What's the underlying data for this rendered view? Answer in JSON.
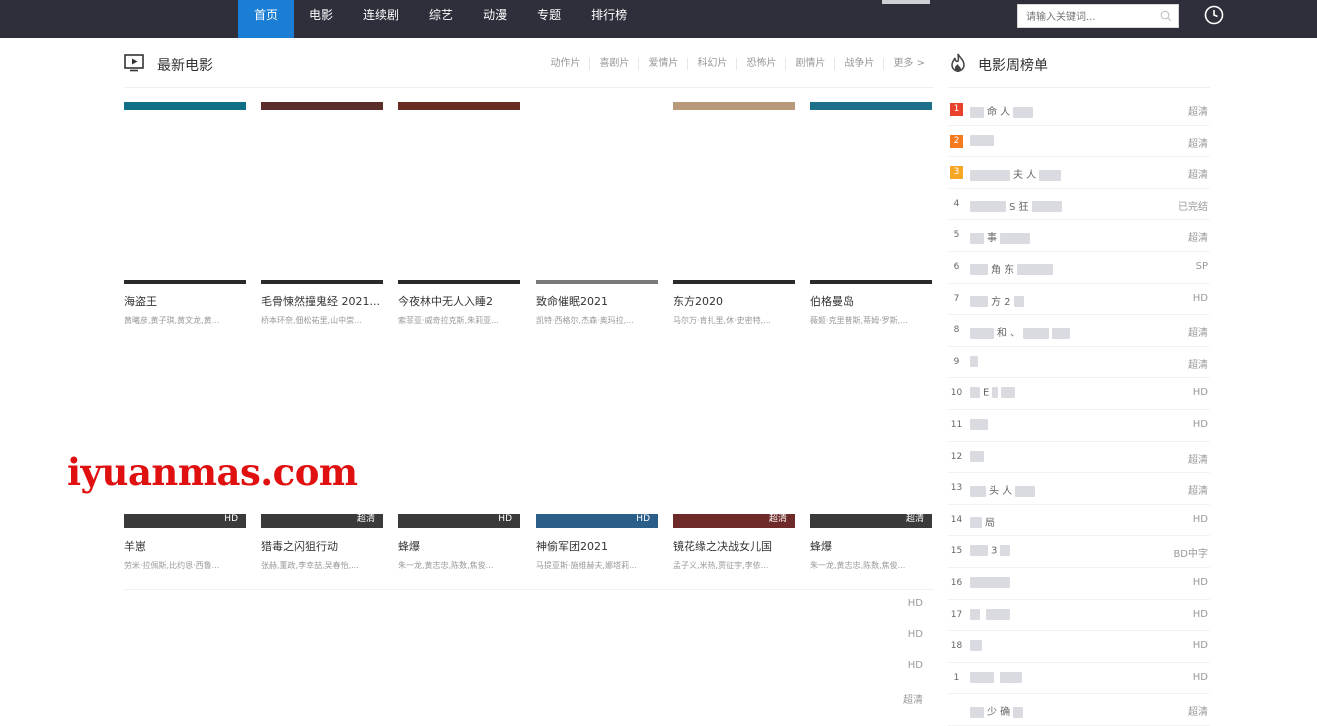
{
  "nav": {
    "items": [
      "首页",
      "电影",
      "连续剧",
      "综艺",
      "动漫",
      "专题",
      "排行榜"
    ],
    "active": "首页"
  },
  "search": {
    "placeholder": "请输入关键词..."
  },
  "section": {
    "title": "最新电影",
    "categories": [
      "动作片",
      "喜剧片",
      "爱情片",
      "科幻片",
      "恐怖片",
      "剧情片",
      "战争片",
      "更多 >"
    ]
  },
  "movies_row1": [
    {
      "title": "海盗王",
      "cast": "黄曦彦,黄子琪,黄文龙,黄...",
      "strip": "#0e6f86"
    },
    {
      "title": "毛骨悚然撞鬼经 2021...",
      "cast": "桥本环奈,佃松祐里,山中崇...",
      "strip": "#5a2f2a"
    },
    {
      "title": "今夜林中无人入睡2",
      "cast": "索菲亚·威奇拉克斯,朱莉亚...",
      "strip": "#6a2b22"
    },
    {
      "title": "致命催眠2021",
      "cast": "凯特·西格尔,杰森·奥玛拉,...",
      "strip": "#ffffff"
    },
    {
      "title": "东方2020",
      "cast": "马尔万·肯扎里,休·史密特,...",
      "strip": "#b89a7a"
    },
    {
      "title": "伯格曼岛",
      "cast": "薇姬·克里普斯,蒂姆·罗斯,...",
      "strip": "#1d6f8a"
    }
  ],
  "movies_row2": [
    {
      "title": "羊崽",
      "cast": "劳米·拉佩斯,比约恩·西鲁...",
      "badge": "HD"
    },
    {
      "title": "猎毒之闪狙行动",
      "cast": "张赫,董政,李幸喆,吴春怡,...",
      "badge": "超清"
    },
    {
      "title": "蜂爆",
      "cast": "朱一龙,黄志忠,陈数,焦俊...",
      "badge": "HD"
    },
    {
      "title": "神偷军团2021",
      "cast": "马提亚斯·施维赫夫,娜塔莉...",
      "badge": "HD"
    },
    {
      "title": "镜花缘之决战女儿国",
      "cast": "孟子义,米热,贾征宇,李依...",
      "badge": "超清"
    },
    {
      "title": "蜂爆",
      "cast": "朱一龙,黄志忠,陈数,焦俊...",
      "badge": "超清"
    }
  ],
  "extra_badges": [
    "HD",
    "HD",
    "HD",
    "超清"
  ],
  "watermark": "iyuanmas.com",
  "ranking": {
    "title": "电影周榜单",
    "items": [
      {
        "num": "1",
        "name": "命 人",
        "badge": "超清"
      },
      {
        "num": "2",
        "name": "",
        "badge": "超清"
      },
      {
        "num": "3",
        "name": "夫 人",
        "badge": "超清"
      },
      {
        "num": "4",
        "name": "S 狂",
        "badge": "已完结"
      },
      {
        "num": "5",
        "name": "事",
        "badge": "超清"
      },
      {
        "num": "6",
        "name": "角 东",
        "badge": "SP"
      },
      {
        "num": "7",
        "name": "方 2",
        "badge": "HD"
      },
      {
        "num": "8",
        "name": "和 、",
        "badge": "超清"
      },
      {
        "num": "9",
        "name": "",
        "badge": "超清"
      },
      {
        "num": "10",
        "name": "E",
        "badge": "HD"
      },
      {
        "num": "11",
        "name": "",
        "badge": "HD"
      },
      {
        "num": "12",
        "name": "",
        "badge": "超清"
      },
      {
        "num": "13",
        "name": "头 人",
        "badge": "超清"
      },
      {
        "num": "14",
        "name": "局",
        "badge": "HD"
      },
      {
        "num": "15",
        "name": "3",
        "badge": "BD中字"
      },
      {
        "num": "16",
        "name": "",
        "badge": "HD"
      },
      {
        "num": "17",
        "name": "",
        "badge": "HD"
      },
      {
        "num": "18",
        "name": "",
        "badge": "HD"
      },
      {
        "num": "1",
        "name": "",
        "badge": "HD"
      },
      {
        "num": "",
        "name": "少 确",
        "badge": "超清"
      }
    ]
  },
  "colors": {
    "accent": "#1a7fd4",
    "topbar": "#2e2f3b",
    "rank1": "#e8412c",
    "rank2": "#f37b1d",
    "rank3": "#f5a623"
  }
}
